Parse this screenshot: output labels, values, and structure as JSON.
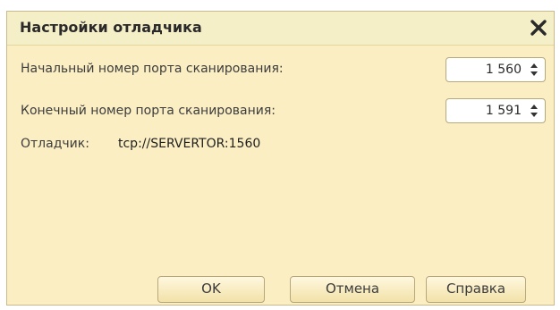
{
  "dialog": {
    "title": "Настройки отладчика",
    "close_icon": "close-icon"
  },
  "fields": {
    "start_port_label": "Начальный номер порта сканирования:",
    "start_port_value": "1 560",
    "end_port_label": "Конечный номер порта сканирования:",
    "end_port_value": "1 591"
  },
  "debugger": {
    "label": "Отладчик:",
    "value": "tcp://SERVERTOR:1560"
  },
  "buttons": {
    "ok": "OK",
    "cancel": "Отмена",
    "help": "Справка"
  },
  "colors": {
    "dialog_background": "#fbeec3",
    "title_background": "#f5efc8",
    "button_background": "#f6e8b8"
  }
}
